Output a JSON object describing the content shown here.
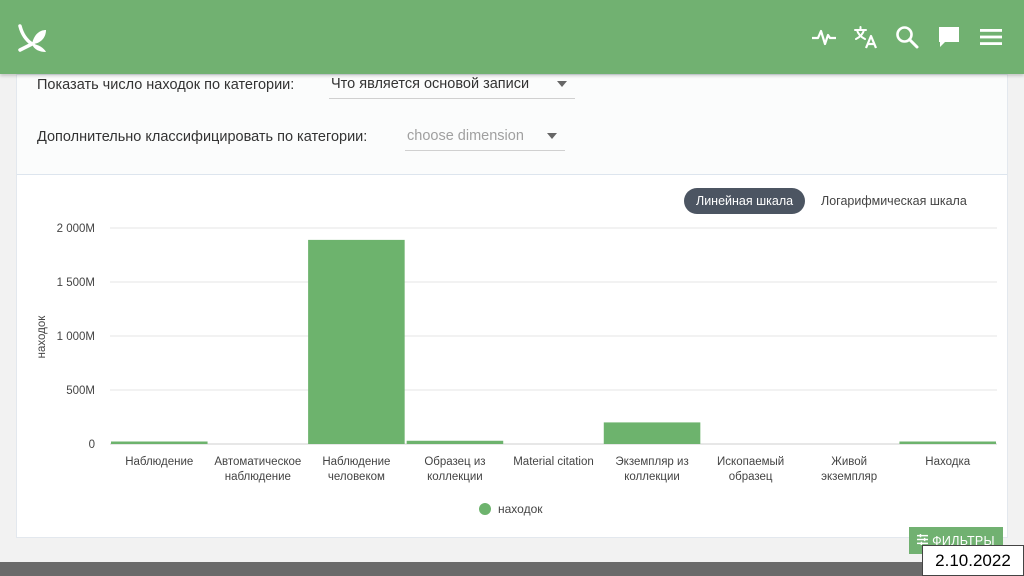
{
  "header": {
    "icons": [
      "leaf-logo-icon",
      "activity-pulse-icon",
      "translate-icon",
      "search-icon",
      "chat-icon",
      "menu-icon"
    ]
  },
  "controls": {
    "primary_label": "Показать число находок по категории:",
    "primary_value": "Что является основой записи",
    "secondary_label": "Дополнительно классифицировать по категории:",
    "secondary_placeholder": "choose dimension"
  },
  "scale": {
    "linear_label": "Линейная шкала",
    "log_label": "Логарифмическая шкала",
    "active": "linear"
  },
  "chart_data": {
    "type": "bar",
    "ylabel": "находок",
    "ylim": [
      0,
      2000000000
    ],
    "y_ticks": [
      0,
      500000000,
      1000000000,
      1500000000,
      2000000000
    ],
    "y_tick_labels": [
      "0",
      "500M",
      "1 000M",
      "1 500M",
      "2 000M"
    ],
    "categories": [
      [
        "Наблюдение"
      ],
      [
        "Автоматическое",
        "наблюдение"
      ],
      [
        "Наблюдение",
        "человеком"
      ],
      [
        "Образец из",
        "коллекции"
      ],
      [
        "Material citation"
      ],
      [
        "Экземпляр из",
        "коллекции"
      ],
      [
        "Ископаемый",
        "образец"
      ],
      [
        "Живой",
        "экземпляр"
      ],
      [
        "Находка"
      ]
    ],
    "series": [
      {
        "name": "находок",
        "values": [
          15000000,
          0,
          1890000000,
          30000000,
          0,
          200000000,
          0,
          0,
          15000000
        ]
      }
    ],
    "legend_position": "bottom-center",
    "grid": true,
    "color": "#6db36d"
  },
  "buttons": {
    "filters_label": "ФИЛЬТРЫ"
  },
  "footer": {
    "date": "2.10.2022"
  },
  "colors": {
    "brand": "#71b171",
    "bar": "#6db36d",
    "active_toggle": "#4c5562"
  }
}
